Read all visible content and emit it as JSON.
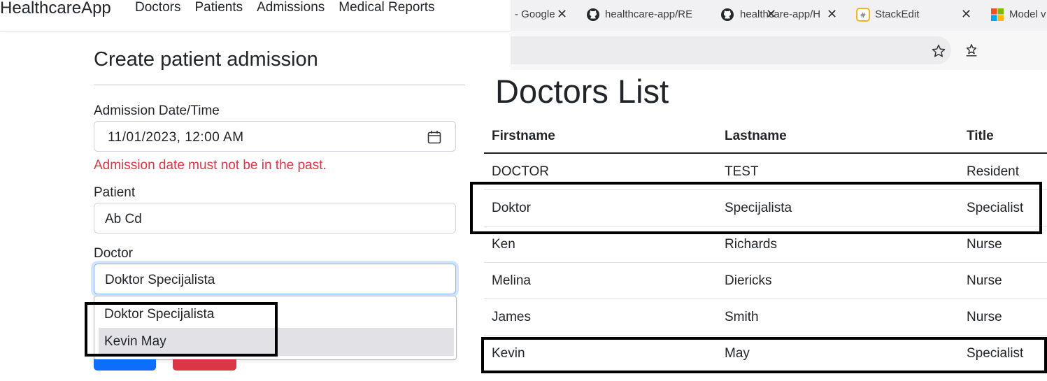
{
  "app": {
    "brand": "HealthcareApp",
    "nav": [
      "Doctors",
      "Patients",
      "Admissions",
      "Medical Reports"
    ]
  },
  "form": {
    "title": "Create patient admission",
    "admission_label": "Admission Date/Time",
    "admission_value": "11/01/2023, 12:00  AM",
    "admission_error": "Admission date must not be in the past.",
    "patient_label": "Patient",
    "patient_value": "Ab Cd",
    "doctor_label": "Doctor",
    "doctor_value": "Doktor Specijalista",
    "doctor_options": [
      "Doktor Specijalista",
      "Kevin May"
    ],
    "highlighted_option": "Kevin May"
  },
  "browser": {
    "tabs": [
      {
        "label": "- Google",
        "icon": "google-tab"
      },
      {
        "label": "healthcare-app/RE",
        "icon": "github-icon"
      },
      {
        "label": "healthcare-app/H",
        "icon": "github-icon"
      },
      {
        "label": "StackEdit",
        "icon": "stackedit-icon"
      },
      {
        "label": "Model v",
        "icon": "microsoft-icon"
      }
    ],
    "close_glyph": "✕"
  },
  "doctors_page": {
    "heading": "Doctors List",
    "columns": [
      "Firstname",
      "Lastname",
      "Title"
    ],
    "rows": [
      [
        "DOCTOR",
        "TEST",
        "Resident"
      ],
      [
        "Doktor",
        "Specijalista",
        "Specialist"
      ],
      [
        "Ken",
        "Richards",
        "Nurse"
      ],
      [
        "Melina",
        "Diericks",
        "Nurse"
      ],
      [
        "James",
        "Smith",
        "Nurse"
      ],
      [
        "Kevin",
        "May",
        "Specialist"
      ]
    ]
  },
  "colors": {
    "primary": "#0d6efd",
    "danger": "#dc3545",
    "focus_border": "#86b7fe",
    "option_highlight": "#e1e1e6"
  }
}
